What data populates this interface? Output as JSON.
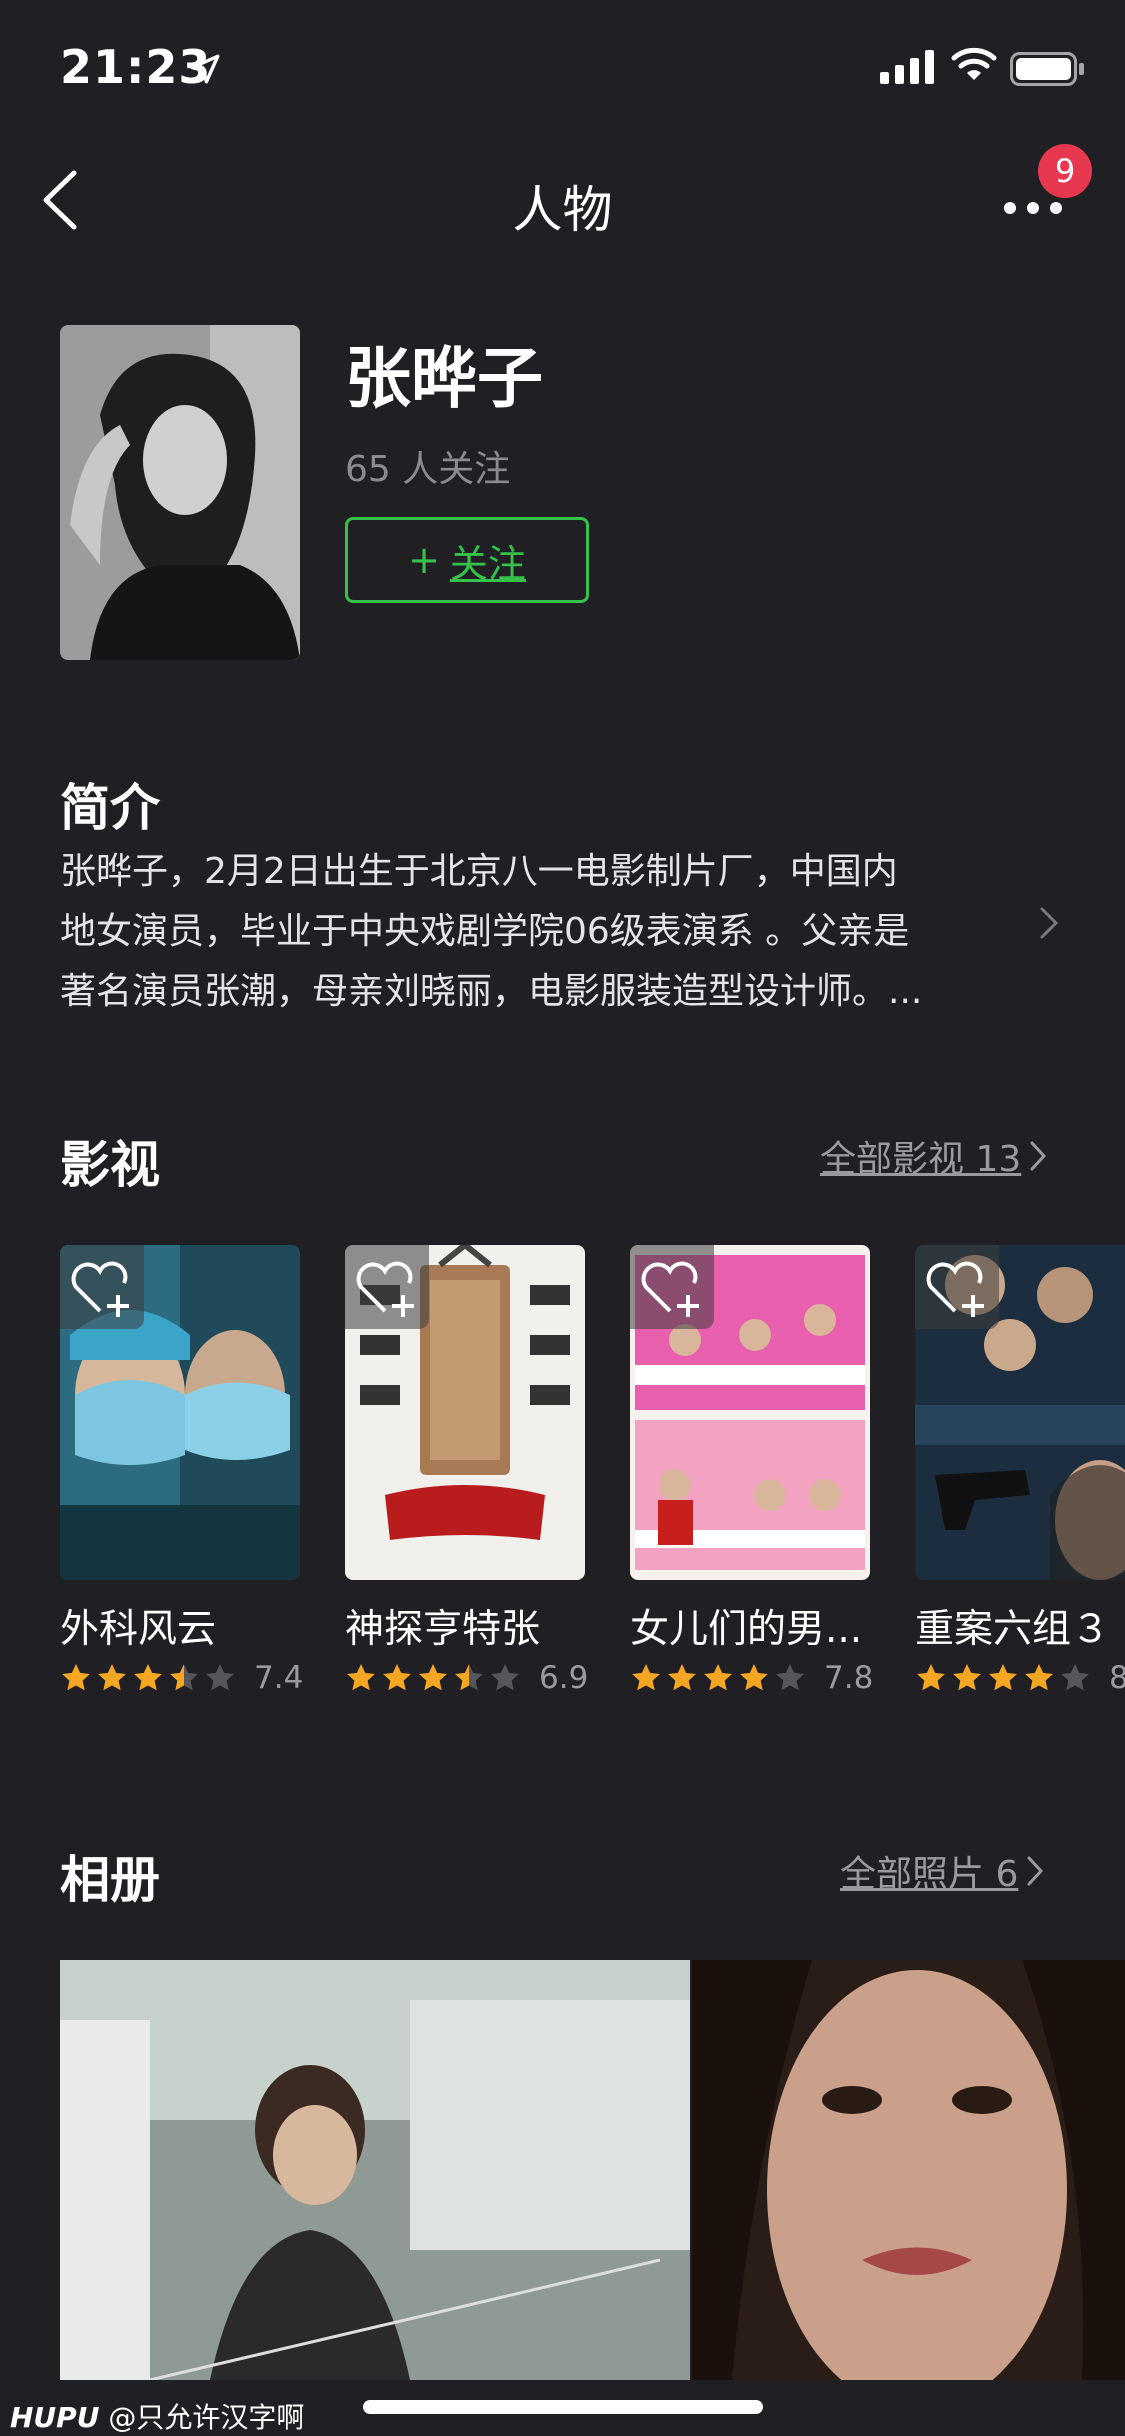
{
  "status_bar": {
    "time": "21:23"
  },
  "nav": {
    "title": "人物",
    "badge_count": "9"
  },
  "profile": {
    "name": "张晔子",
    "followers": "65 人关注",
    "follow_label": "关注",
    "follow_plus": "+"
  },
  "intro": {
    "title": "简介",
    "lines": [
      "张晔子，2月2日出生于北京八一电影制片厂，中国内",
      "地女演员，毕业于中央戏剧学院06级表演系 。父亲是",
      "著名演员张潮，母亲刘晓丽，电影服装造型设计师。..."
    ]
  },
  "works": {
    "title": "影视",
    "all_label": "全部影视 13",
    "items": [
      {
        "title": "外科风云",
        "rating": "7.4",
        "stars": 3.5
      },
      {
        "title": "神探亨特张",
        "rating": "6.9",
        "stars": 3.5
      },
      {
        "title": "女儿们的男...",
        "rating": "7.8",
        "stars": 4
      },
      {
        "title": "重案六组３",
        "rating": "8",
        "stars": 4
      }
    ]
  },
  "album": {
    "title": "相册",
    "all_label": "全部照片 6"
  },
  "watermark": {
    "brand": "HUPU",
    "user": "@只允许汉字啊"
  },
  "colors": {
    "background": "#1f1f24",
    "accent_green": "#36c24a",
    "badge_red": "#e8384f",
    "star": "#f5a623"
  }
}
